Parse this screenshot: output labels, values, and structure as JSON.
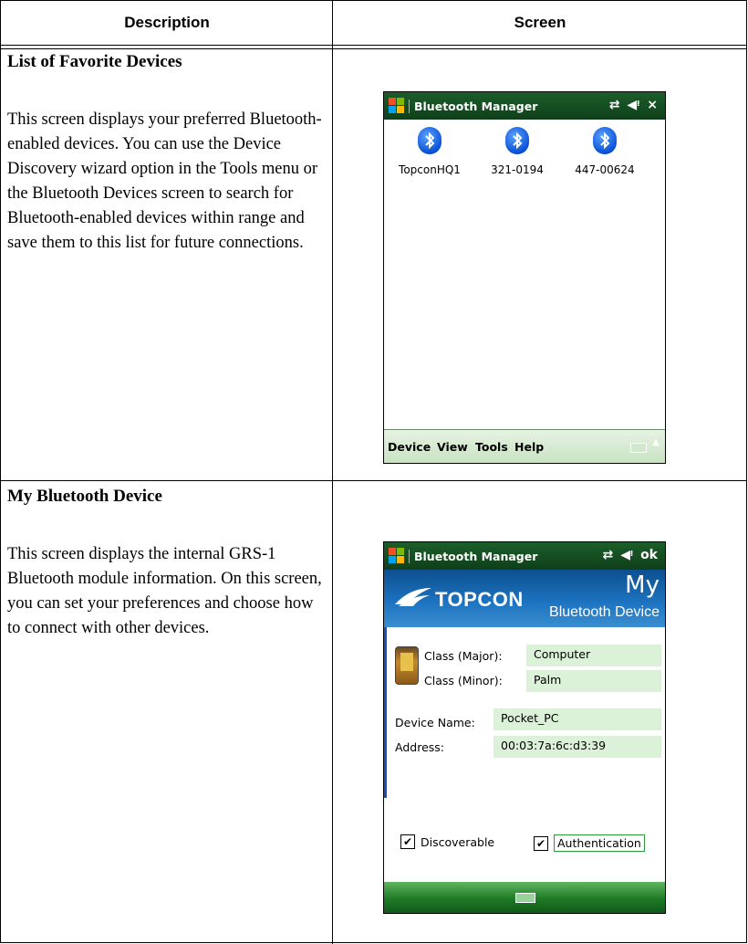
{
  "table": {
    "header": {
      "description": "Description",
      "screen": "Screen"
    },
    "rows": [
      {
        "title": "List of Favorite Devices",
        "body": "This screen displays your preferred Bluetooth-enabled devices. You can use the Device Discovery wizard option in the Tools menu or the Bluetooth Devices screen to search for Bluetooth-enabled devices within range and save them to this list for future connections."
      },
      {
        "title": "My Bluetooth Device",
        "body": "This screen displays the internal GRS-1 Bluetooth module information. On this screen, you can set your preferences and choose how to connect with other devices."
      }
    ]
  },
  "favorites_screen": {
    "title": "Bluetooth Manager",
    "close_label": "×",
    "devices": [
      "TopconHQ1",
      "321-0194",
      "447-00624"
    ],
    "menu": [
      "Device",
      "View",
      "Tools",
      "Help"
    ]
  },
  "my_device_screen": {
    "title": "Bluetooth Manager",
    "ok_label": "ok",
    "banner_my": "My",
    "banner_subtitle": "Bluetooth Device",
    "brand": "TOPCON",
    "class_major_label": "Class (Major):",
    "class_major_value": "Computer",
    "class_minor_label": "Class (Minor):",
    "class_minor_value": "Palm",
    "device_name_label": "Device Name:",
    "device_name_value": "Pocket_PC",
    "address_label": "Address:",
    "address_value": "00:03:7a:6c:d3:39",
    "discoverable_label": "Discoverable",
    "discoverable_checked": true,
    "authentication_label": "Authentication",
    "authentication_checked": true
  },
  "colors": {
    "titlebar": "#1c5e2a",
    "menubar": "#d6ead2",
    "banner": "#1c72bf",
    "field_bg": "#dcf2d8",
    "bluetooth": "#0a52d8"
  }
}
